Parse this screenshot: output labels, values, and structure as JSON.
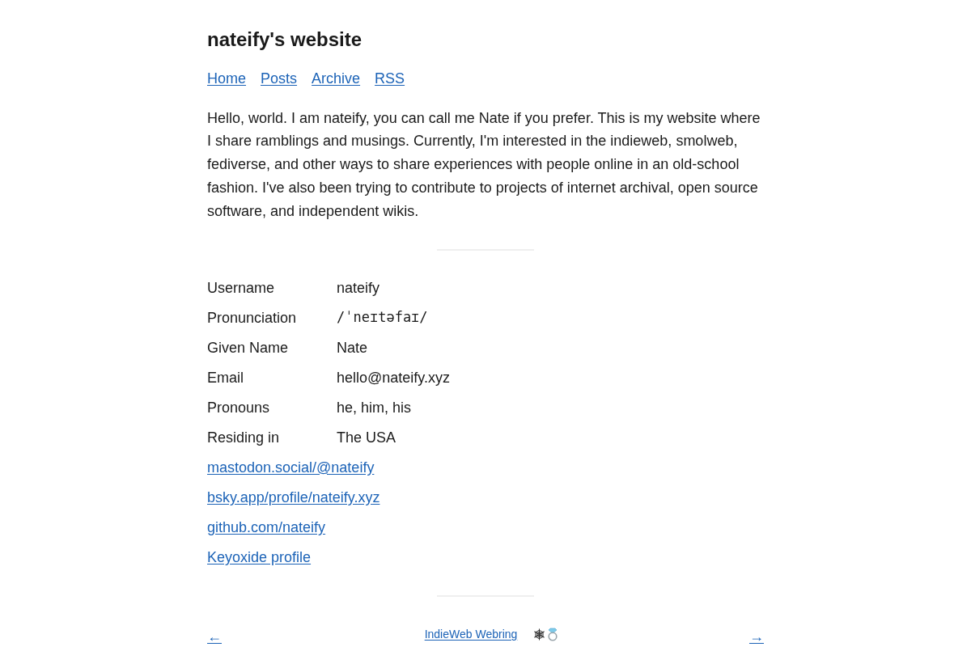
{
  "site_title": "nateify's website",
  "nav": [
    "Home",
    "Posts",
    "Archive",
    "RSS"
  ],
  "intro": "Hello, world. I am nateify, you can call me Nate if you prefer. This is my website where I share ramblings and musings. Currently, I'm interested in the indieweb, smolweb, fediverse, and other ways to share experiences with people online in an old-school fashion. I've also been trying to contribute to projects of internet archival, open source software, and independent wikis.",
  "profile": [
    {
      "label": "Username",
      "value": "nateify",
      "kind": "text"
    },
    {
      "label": "Pronunciation",
      "value": "/ˈneɪtəfaɪ/",
      "kind": "ipa"
    },
    {
      "label": "Given Name",
      "value": "Nate",
      "kind": "text"
    },
    {
      "label": "Email",
      "value": "hello@nateify.xyz",
      "kind": "text"
    },
    {
      "label": "Pronouns",
      "value": "he, him, his",
      "kind": "text"
    },
    {
      "label": "Residing in",
      "value": "The USA",
      "kind": "text"
    }
  ],
  "links": [
    "mastodon.social/@nateify",
    "bsky.app/profile/nateify.xyz",
    "github.com/nateify",
    "Keyoxide profile"
  ],
  "webring": {
    "previous": "←",
    "name": "IndieWeb Webring",
    "next": "→"
  }
}
